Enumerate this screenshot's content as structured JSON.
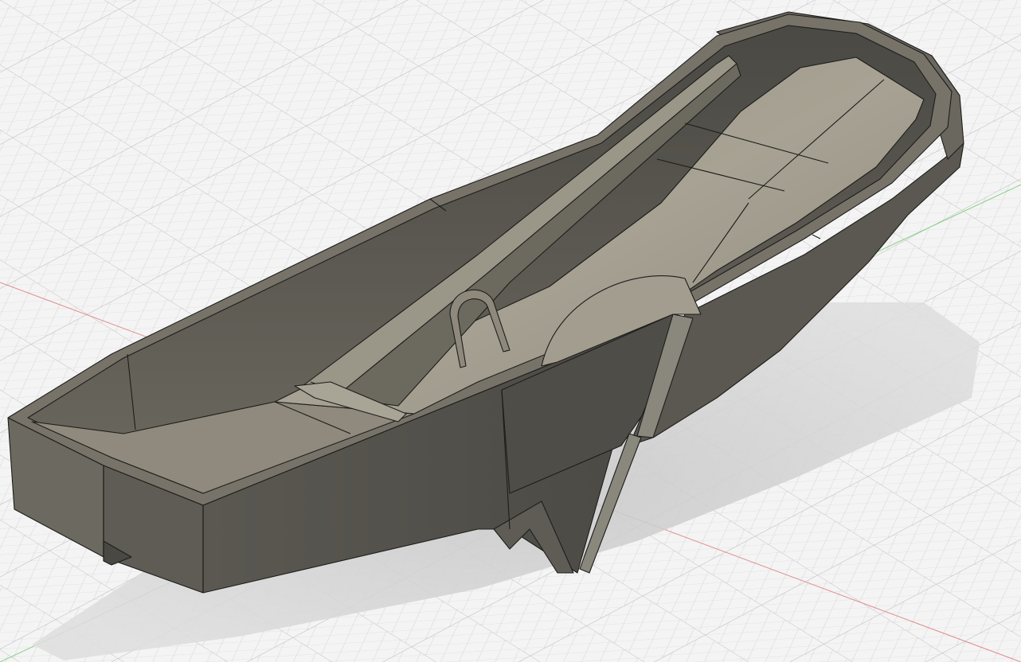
{
  "app": "3D CAD viewport",
  "viewport": {
    "background": "#f4f4f4",
    "grid_color": "#c9c9c9",
    "axis_x_color": "#e07a7a",
    "axis_y_color": "#7ccf7c"
  },
  "model": {
    "body_color": "#6f6c63",
    "wall_color": "#58564f",
    "inner_floor_color": "#9c978a",
    "shadow_color": "#cfcfcf",
    "edge_color": "#1d1d1b"
  },
  "icons": [
    "cad-model",
    "ground-grid",
    "x-axis",
    "y-axis"
  ]
}
